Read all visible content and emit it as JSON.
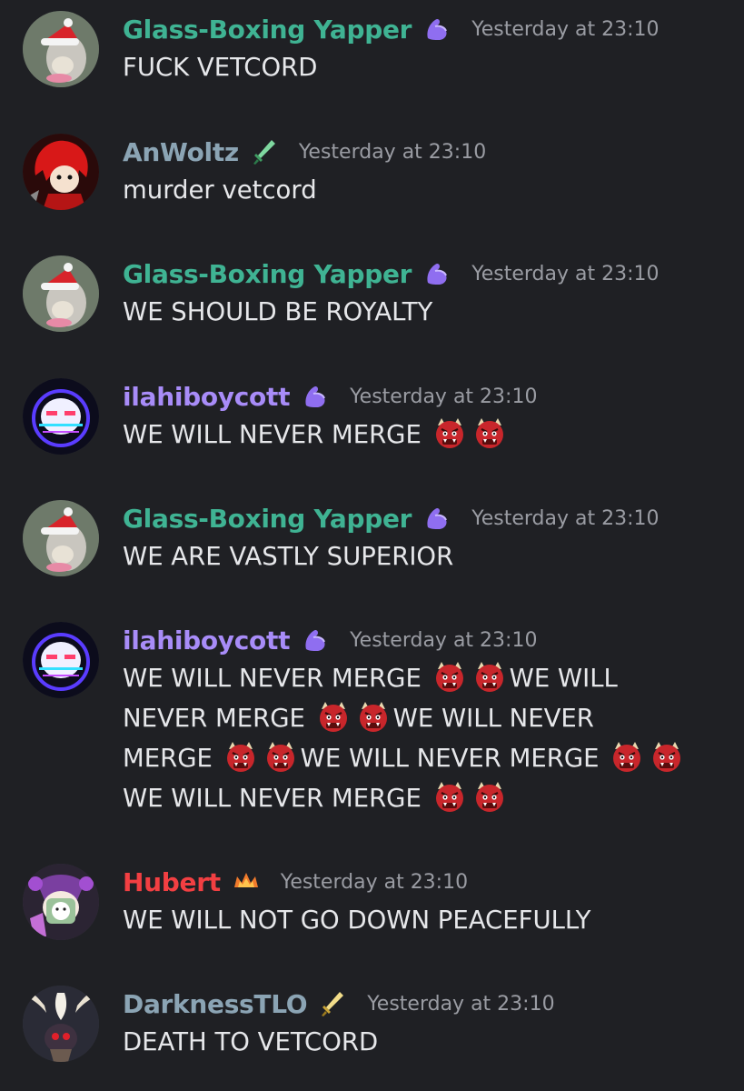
{
  "colors": {
    "background": "#1f2024",
    "timestamp": "#9a9ca3",
    "message_text": "#e6e7ea",
    "name_glass_boxing": "#3fb393",
    "name_anwoltz": "#8ba4b4",
    "name_ilahiboycott": "#a88cf8",
    "name_hubert": "#f23f42",
    "name_darkness": "#8ba4b4"
  },
  "messages": [
    {
      "author": "Glass-Boxing Yapper",
      "role_icon": "flexed-biceps-icon",
      "timestamp": "Yesterday at 23:10",
      "lines": [
        "FUCK VETCORD"
      ]
    },
    {
      "author": "AnWoltz",
      "role_icon": "green-sword-icon",
      "timestamp": "Yesterday at 23:10",
      "lines": [
        "murder vetcord"
      ]
    },
    {
      "author": "Glass-Boxing Yapper",
      "role_icon": "flexed-biceps-icon",
      "timestamp": "Yesterday at 23:10",
      "lines": [
        "WE SHOULD BE ROYALTY"
      ]
    },
    {
      "author": "ilahiboycott",
      "role_icon": "flexed-biceps-icon",
      "timestamp": "Yesterday at 23:10",
      "lines": [
        "WE WILL NEVER MERGE"
      ]
    },
    {
      "author": "Glass-Boxing Yapper",
      "role_icon": "flexed-biceps-icon",
      "timestamp": "Yesterday at 23:10",
      "lines": [
        "WE ARE VASTLY SUPERIOR"
      ]
    },
    {
      "author": "ilahiboycott",
      "role_icon": "flexed-biceps-icon",
      "timestamp": "Yesterday at 23:10",
      "segments": [
        "WE WILL NEVER MERGE",
        "WE WILL",
        "NEVER MERGE",
        "WE WILL NEVER",
        "MERGE",
        "WE WILL NEVER MERGE",
        "WE WILL NEVER MERGE"
      ]
    },
    {
      "author": "Hubert",
      "role_icon": "flame-crown-icon",
      "timestamp": "Yesterday at 23:10",
      "lines": [
        "WE WILL NOT GO DOWN PEACEFULLY"
      ]
    },
    {
      "author": "DarknessTLO",
      "role_icon": "gold-sword-icon",
      "timestamp": "Yesterday at 23:10",
      "lines": [
        "DEATH TO VETCORD"
      ]
    }
  ]
}
